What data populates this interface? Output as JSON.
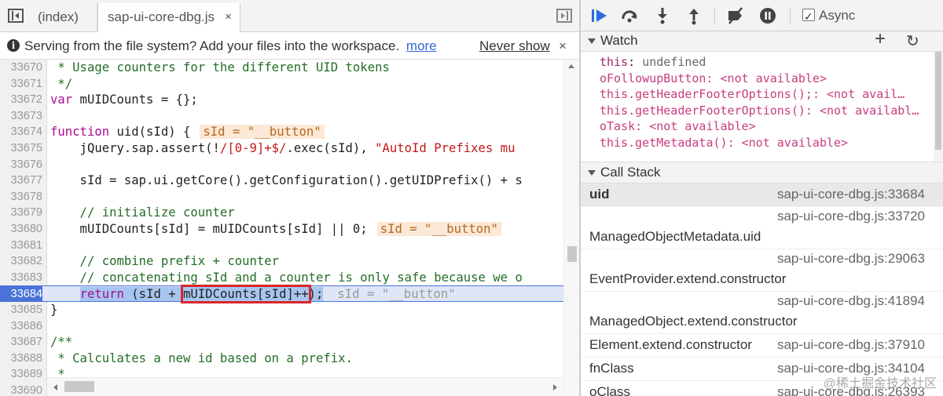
{
  "tabs": [
    {
      "label": "(index)"
    },
    {
      "label": "sap-ui-core-dbg.js",
      "close": "×"
    }
  ],
  "infobar": {
    "message": "Serving from the file system? Add your files into the workspace.",
    "more": "more",
    "never_show": "Never show",
    "close": "×"
  },
  "code": {
    "lines": [
      {
        "n": "33670",
        "text": " * Usage counters for the different UID tokens"
      },
      {
        "n": "33671",
        "text": " */"
      },
      {
        "n": "33672",
        "text": "var mUIDCounts = {};"
      },
      {
        "n": "33673",
        "text": ""
      },
      {
        "n": "33674",
        "text": "function uid(sId) {",
        "inline": "sId = \"__button\""
      },
      {
        "n": "33675",
        "text": "    jQuery.sap.assert(!/[0-9]+$/.exec(sId), \"AutoId Prefixes mu"
      },
      {
        "n": "33676",
        "text": ""
      },
      {
        "n": "33677",
        "text": "    sId = sap.ui.getCore().getConfiguration().getUIDPrefix() + s"
      },
      {
        "n": "33678",
        "text": ""
      },
      {
        "n": "33679",
        "text": "    // initialize counter"
      },
      {
        "n": "33680",
        "text": "    mUIDCounts[sId] = mUIDCounts[sId] || 0;",
        "inline": "sId = \"__button\""
      },
      {
        "n": "33681",
        "text": ""
      },
      {
        "n": "33682",
        "text": "    // combine prefix + counter"
      },
      {
        "n": "33683",
        "text": "    // concatenating sId and a counter is only safe because we o"
      },
      {
        "n": "33684",
        "text": "    return (sId + mUIDCounts[sId]++);",
        "inline": "sId = \"__button\""
      },
      {
        "n": "33685",
        "text": "}"
      },
      {
        "n": "33686",
        "text": ""
      },
      {
        "n": "33687",
        "text": "/**"
      },
      {
        "n": "33688",
        "text": " * Calculates a new id based on a prefix."
      },
      {
        "n": "33689",
        "text": " *"
      },
      {
        "n": "33690",
        "text": ""
      }
    ],
    "exec_line": "33684",
    "highlighted_expr": "mUIDCounts[sId]++"
  },
  "toolbar": {
    "async_label": "Async",
    "async_checked": true
  },
  "watch": {
    "title": "Watch",
    "add": "+",
    "refresh": "↻",
    "items": [
      {
        "expr": "this",
        "sep": ": ",
        "value": "undefined",
        "kind": "undef"
      },
      {
        "expr": "oFollowupButton",
        "sep": ": ",
        "value": "<not available>",
        "kind": "na"
      },
      {
        "expr": "this.getHeaderFooterOptions();",
        "sep": ": ",
        "value": "<not avail…",
        "kind": "na"
      },
      {
        "expr": "this.getHeaderFooterOptions()",
        "sep": ": ",
        "value": "<not availabl…",
        "kind": "na"
      },
      {
        "expr": "oTask",
        "sep": ": ",
        "value": "<not available>",
        "kind": "na"
      },
      {
        "expr": "this.getMetadata()",
        "sep": ": ",
        "value": "<not available>",
        "kind": "na"
      }
    ]
  },
  "callstack": {
    "title": "Call Stack",
    "frames": [
      {
        "fn": "uid",
        "loc": "sap-ui-core-dbg.js:33684",
        "active": true
      },
      {
        "fn": "ManagedObjectMetadata.uid",
        "loc": "sap-ui-core-dbg.js:33720"
      },
      {
        "fn": "EventProvider.extend.constructor",
        "loc": "sap-ui-core-dbg.js:29063"
      },
      {
        "fn": "ManagedObject.extend.constructor",
        "loc": "sap-ui-core-dbg.js:41894"
      },
      {
        "fn": "Element.extend.constructor",
        "loc": "sap-ui-core-dbg.js:37910"
      },
      {
        "fn": "fnClass",
        "loc": "sap-ui-core-dbg.js:34104"
      },
      {
        "fn": "oClass",
        "loc": "sap-ui-core-dbg.js:26393"
      }
    ]
  },
  "watermark": "@稀土掘金技术社区",
  "colors": {
    "accent": "#4a73d8",
    "highlight_border": "#d9252a"
  }
}
